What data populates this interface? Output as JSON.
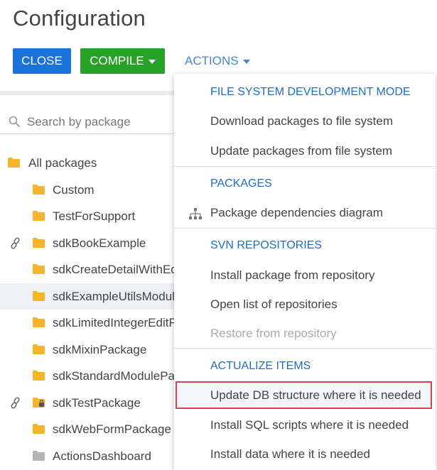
{
  "page": {
    "title": "Configuration"
  },
  "toolbar": {
    "close_label": "CLOSE",
    "compile_label": "COMPILE",
    "actions_label": "ACTIONS"
  },
  "search": {
    "placeholder": "Search by package"
  },
  "tree": {
    "items": [
      {
        "label": "All packages"
      },
      {
        "label": "Custom"
      },
      {
        "label": "TestForSupport"
      },
      {
        "label": "sdkBookExample"
      },
      {
        "label": "sdkCreateDetailWithEd"
      },
      {
        "label": "sdkExampleUtilsModul"
      },
      {
        "label": "sdkLimitedIntegerEditF"
      },
      {
        "label": "sdkMixinPackage"
      },
      {
        "label": "sdkStandardModulePa"
      },
      {
        "label": "sdkTestPackage"
      },
      {
        "label": "sdkWebFormPackage"
      },
      {
        "label": "ActionsDashboard"
      }
    ]
  },
  "menu": {
    "items": [
      {
        "label": "FILE SYSTEM DEVELOPMENT MODE"
      },
      {
        "label": "Download packages to file system"
      },
      {
        "label": "Update packages from file system"
      },
      {
        "label": "PACKAGES"
      },
      {
        "label": "Package dependencies diagram"
      },
      {
        "label": "SVN REPOSITORIES"
      },
      {
        "label": "Install package from repository"
      },
      {
        "label": "Open list of repositories"
      },
      {
        "label": "Restore from repository"
      },
      {
        "label": "ACTUALIZE ITEMS"
      },
      {
        "label": "Update DB structure where it is needed"
      },
      {
        "label": "Install SQL scripts where it is needed"
      },
      {
        "label": "Install data where it is needed"
      }
    ]
  },
  "colors": {
    "close_button": "#1a73d8",
    "compile_button": "#26a326",
    "link_blue": "#1f6dc2",
    "folder_yellow": "#f5b52a",
    "folder_gray": "#b5b5b5",
    "highlight_border": "#d9414b"
  }
}
